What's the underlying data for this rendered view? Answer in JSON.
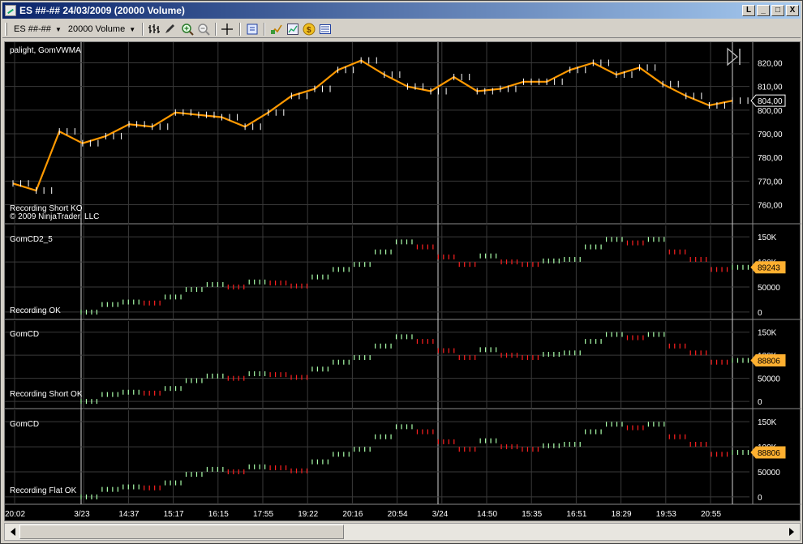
{
  "window": {
    "title": "ES ##-##  24/03/2009 (20000 Volume)",
    "controls": [
      "L",
      "_",
      "□",
      "X"
    ]
  },
  "toolbar": {
    "instrument": "ES ##-##",
    "interval": "20000 Volume",
    "icons": [
      "bar-chart-icon",
      "pen-icon",
      "zoom-in-icon",
      "zoom-out-icon",
      "crosshair-icon",
      "properties-icon",
      "indicators-icon",
      "strategy-icon",
      "money-icon",
      "data-box-icon"
    ]
  },
  "panels": {
    "price": {
      "label": "palight, GomVWMA",
      "status_1": "Recording Short KO",
      "status_2": "© 2009 NinjaTrader, LLC",
      "y_ticks": [
        "820,00",
        "810,00",
        "800,00",
        "790,00",
        "780,00",
        "770,00",
        "760,00"
      ],
      "last_value": "804,00"
    },
    "cd1": {
      "label": "GomCD2_5",
      "status": "Recording OK",
      "y_ticks": [
        "150K",
        "100K",
        "50000",
        "0"
      ],
      "last_value": "89243"
    },
    "cd2": {
      "label": "GomCD",
      "status": "Recording Short OK",
      "y_ticks": [
        "150K",
        "100K",
        "50000",
        "0"
      ],
      "last_value": "88806"
    },
    "cd3": {
      "label": "GomCD",
      "status": "Recording Flat OK",
      "y_ticks": [
        "150K",
        "100K",
        "50000",
        "0"
      ],
      "last_value": "88806"
    }
  },
  "x_axis": [
    "20:02",
    "3/23",
    "14:37",
    "15:17",
    "16:15",
    "17:55",
    "19:22",
    "20:16",
    "20:54",
    "3/24",
    "14:50",
    "15:35",
    "16:51",
    "18:29",
    "19:53",
    "20:55"
  ],
  "colors": {
    "price_line": "#ff9900",
    "up_bar": "#aaffaa",
    "down_bar": "#ff2020",
    "marker_bg": "#ffb030",
    "grid": "#3a3a3a"
  },
  "chart_data": [
    {
      "type": "line",
      "name": "price",
      "x_labels": [
        "20:02",
        "3/23",
        "14:37",
        "15:17",
        "16:15",
        "17:55",
        "19:22",
        "20:16",
        "20:54",
        "3/24",
        "14:50",
        "15:35",
        "16:51",
        "18:29",
        "19:53",
        "20:55"
      ],
      "series": [
        {
          "name": "GomVWMA",
          "values": [
            769,
            766,
            791,
            786,
            789,
            794,
            793,
            799,
            798,
            797,
            793,
            799,
            806,
            809,
            817,
            821,
            815,
            810,
            808,
            814,
            808,
            809,
            812,
            812,
            817,
            820,
            815,
            818,
            811,
            806,
            802,
            804
          ]
        }
      ],
      "ylim": [
        754,
        826
      ],
      "y_ticks": [
        760,
        770,
        780,
        790,
        800,
        810,
        820
      ],
      "last": 804.0
    },
    {
      "type": "line",
      "name": "GomCD2_5",
      "series": [
        {
          "name": "GomCD2_5",
          "values": [
            0,
            15000,
            20000,
            18000,
            30000,
            45000,
            55000,
            50000,
            60000,
            58000,
            52000,
            70000,
            85000,
            95000,
            120000,
            140000,
            130000,
            110000,
            95000,
            112000,
            100000,
            95000,
            102000,
            105000,
            130000,
            145000,
            138000,
            145000,
            120000,
            105000,
            85000,
            89243
          ]
        }
      ],
      "ylim": [
        -5000,
        160000
      ],
      "y_ticks": [
        0,
        50000,
        100000,
        150000
      ],
      "last": 89243
    },
    {
      "type": "line",
      "name": "GomCD",
      "series": [
        {
          "name": "GomCD",
          "values": [
            0,
            15000,
            20000,
            18000,
            28000,
            45000,
            55000,
            50000,
            60000,
            58000,
            52000,
            70000,
            85000,
            95000,
            120000,
            140000,
            130000,
            110000,
            95000,
            112000,
            100000,
            95000,
            102000,
            105000,
            130000,
            145000,
            138000,
            145000,
            120000,
            105000,
            85000,
            88806
          ]
        }
      ],
      "ylim": [
        -5000,
        160000
      ],
      "y_ticks": [
        0,
        50000,
        100000,
        150000
      ],
      "last": 88806
    },
    {
      "type": "line",
      "name": "GomCD",
      "series": [
        {
          "name": "GomCD",
          "values": [
            0,
            15000,
            20000,
            18000,
            28000,
            45000,
            55000,
            50000,
            60000,
            58000,
            52000,
            70000,
            85000,
            95000,
            120000,
            140000,
            130000,
            110000,
            95000,
            112000,
            100000,
            95000,
            102000,
            105000,
            130000,
            145000,
            138000,
            145000,
            120000,
            105000,
            85000,
            88806
          ]
        }
      ],
      "ylim": [
        -5000,
        160000
      ],
      "y_ticks": [
        0,
        50000,
        100000,
        150000
      ],
      "last": 88806
    }
  ]
}
